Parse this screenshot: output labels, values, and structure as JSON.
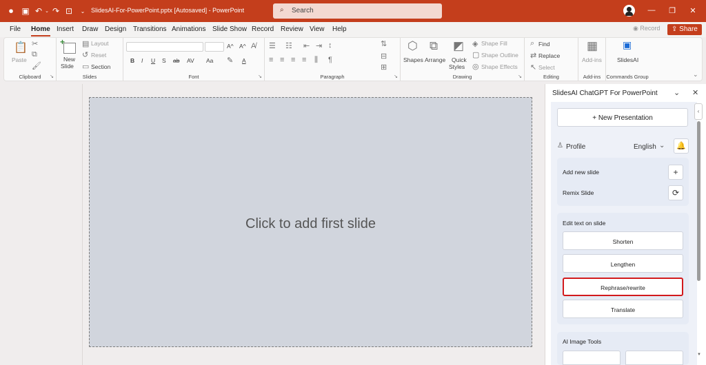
{
  "titlebar": {
    "doc_title": "SlidesAI-For-PowerPoint.pptx [Autosaved]  -  PowerPoint",
    "search_placeholder": "Search",
    "bg": "#c43e1c"
  },
  "menu": {
    "tabs": [
      "File",
      "Home",
      "Insert",
      "Draw",
      "Design",
      "Transitions",
      "Animations",
      "Slide Show",
      "Record",
      "Review",
      "View",
      "Help"
    ],
    "active_tab": "Home",
    "record_label": "Record",
    "share_label": "Share"
  },
  "ribbon": {
    "clipboard": {
      "label": "Clipboard",
      "paste": "Paste"
    },
    "slides": {
      "label": "Slides",
      "new_slide": "New",
      "new_slide2": "Slide",
      "layout": "Layout",
      "reset": "Reset",
      "section": "Section"
    },
    "font": {
      "label": "Font",
      "grow": "A^",
      "shrink": "A^",
      "case": "Aa"
    },
    "paragraph": {
      "label": "Paragraph"
    },
    "drawing": {
      "label": "Drawing",
      "shapes": "Shapes",
      "arrange": "Arrange",
      "quick": "Quick",
      "styles": "Styles",
      "shape_fill": "Shape Fill",
      "shape_outline": "Shape Outline",
      "shape_effects": "Shape Effects"
    },
    "editing": {
      "label": "Editing",
      "find": "Find",
      "replace": "Replace",
      "select": "Select"
    },
    "addins": {
      "label": "Add-ins",
      "button": "Add-ins"
    },
    "commands": {
      "label": "Commands Group",
      "button": "SlidesAI"
    }
  },
  "slide": {
    "placeholder": "Click to add first slide"
  },
  "taskpane": {
    "title": "SlidesAI ChatGPT For PowerPoint",
    "new_presentation": "+  New Presentation",
    "profile": "Profile",
    "language": "English",
    "add_new_slide": "Add new slide",
    "remix_slide": "Remix Slide",
    "edit_text_title": "Edit text on slide",
    "edit_buttons": [
      "Shorten",
      "Lengthen",
      "Rephrase/rewrite",
      "Translate"
    ],
    "highlighted_button": "Rephrase/rewrite",
    "ai_image_tools": "AI Image Tools"
  },
  "colors": {
    "accent": "#c43e1c",
    "highlight_border": "#d2191c",
    "slide_bg": "#d1d5dd",
    "card_bg": "#e6ebf5"
  }
}
